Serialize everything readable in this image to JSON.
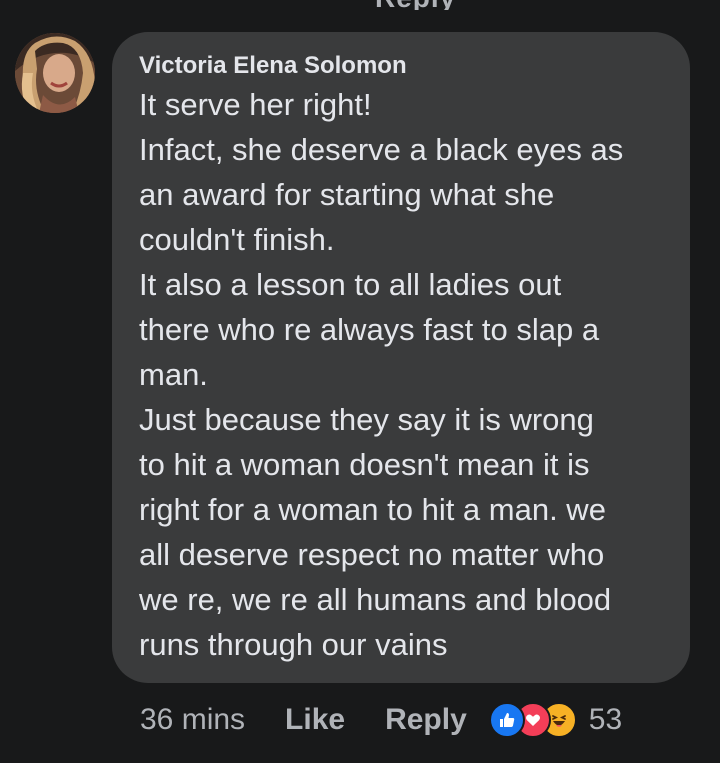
{
  "top_fragment": "Reply",
  "comment": {
    "author": "Victoria Elena Solomon",
    "lines": [
      "It serve her right!",
      "Infact, she deserve a black eyes as",
      "an award for starting what she",
      "couldn't finish.",
      "It also a lesson to all ladies out",
      "there who re always fast to slap a",
      "man.",
      "Just because they say it is wrong",
      "to hit a woman doesn't mean it is",
      "right for a woman to hit a man. we",
      "all deserve respect no matter who",
      "we re, we re all humans and blood",
      "runs through our vains"
    ]
  },
  "actions": {
    "time": "36 mins",
    "like_label": "Like",
    "reply_label": "Reply",
    "reaction_count": "53",
    "reactions": [
      "like-icon",
      "love-icon",
      "haha-icon"
    ]
  },
  "colors": {
    "background": "#18191a",
    "bubble": "#3a3b3c",
    "text": "#e4e6eb",
    "secondary_text": "#b0b3b8",
    "like_blue": "#1877f2",
    "love_red": "#f33e58",
    "haha_yellow": "#f7b125"
  }
}
